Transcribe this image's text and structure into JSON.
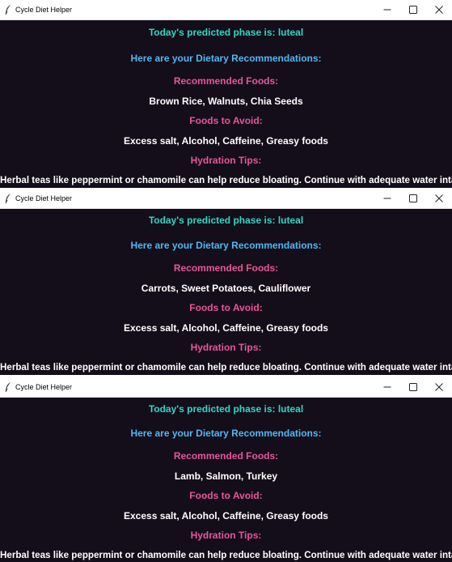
{
  "colors": {
    "background": "#140d1a",
    "phase": "#2ed8c3",
    "header": "#4fb8f2",
    "section": "#e8559a",
    "body": "#ffffff"
  },
  "windows": [
    {
      "title": "Cycle Diet Helper",
      "app_icon": "feather-icon",
      "controls": [
        "minimize-icon",
        "maximize-icon",
        "close-icon"
      ],
      "phase_text": "Today's predicted phase is: luteal",
      "header_text": "Here are your Dietary Recommendations:",
      "recommended_label": "Recommended Foods:",
      "recommended_foods": "Brown Rice, Walnuts, Chia Seeds",
      "avoid_label": "Foods to Avoid:",
      "avoid_foods": "Excess salt, Alcohol, Caffeine, Greasy foods",
      "hydration_label": "Hydration Tips:",
      "hydration_tip": "Herbal teas like peppermint or chamomile can help reduce bloating. Continue with adequate water intake."
    },
    {
      "title": "Cycle Diet Helper",
      "app_icon": "feather-icon",
      "controls": [
        "minimize-icon",
        "maximize-icon",
        "close-icon"
      ],
      "phase_text": "Today's predicted phase is: luteal",
      "header_text": "Here are your Dietary Recommendations:",
      "recommended_label": "Recommended Foods:",
      "recommended_foods": "Carrots, Sweet Potatoes, Cauliflower",
      "avoid_label": "Foods to Avoid:",
      "avoid_foods": "Excess salt, Alcohol, Caffeine, Greasy foods",
      "hydration_label": "Hydration Tips:",
      "hydration_tip": "Herbal teas like peppermint or chamomile can help reduce bloating. Continue with adequate water intake."
    },
    {
      "title": "Cycle Diet Helper",
      "app_icon": "feather-icon",
      "controls": [
        "minimize-icon",
        "maximize-icon",
        "close-icon"
      ],
      "phase_text": "Today's predicted phase is: luteal",
      "header_text": "Here are your Dietary Recommendations:",
      "recommended_label": "Recommended Foods:",
      "recommended_foods": "Lamb, Salmon, Turkey",
      "avoid_label": "Foods to Avoid:",
      "avoid_foods": "Excess salt, Alcohol, Caffeine, Greasy foods",
      "hydration_label": "Hydration Tips:",
      "hydration_tip": "Herbal teas like peppermint or chamomile can help reduce bloating. Continue with adequate water intake."
    }
  ]
}
